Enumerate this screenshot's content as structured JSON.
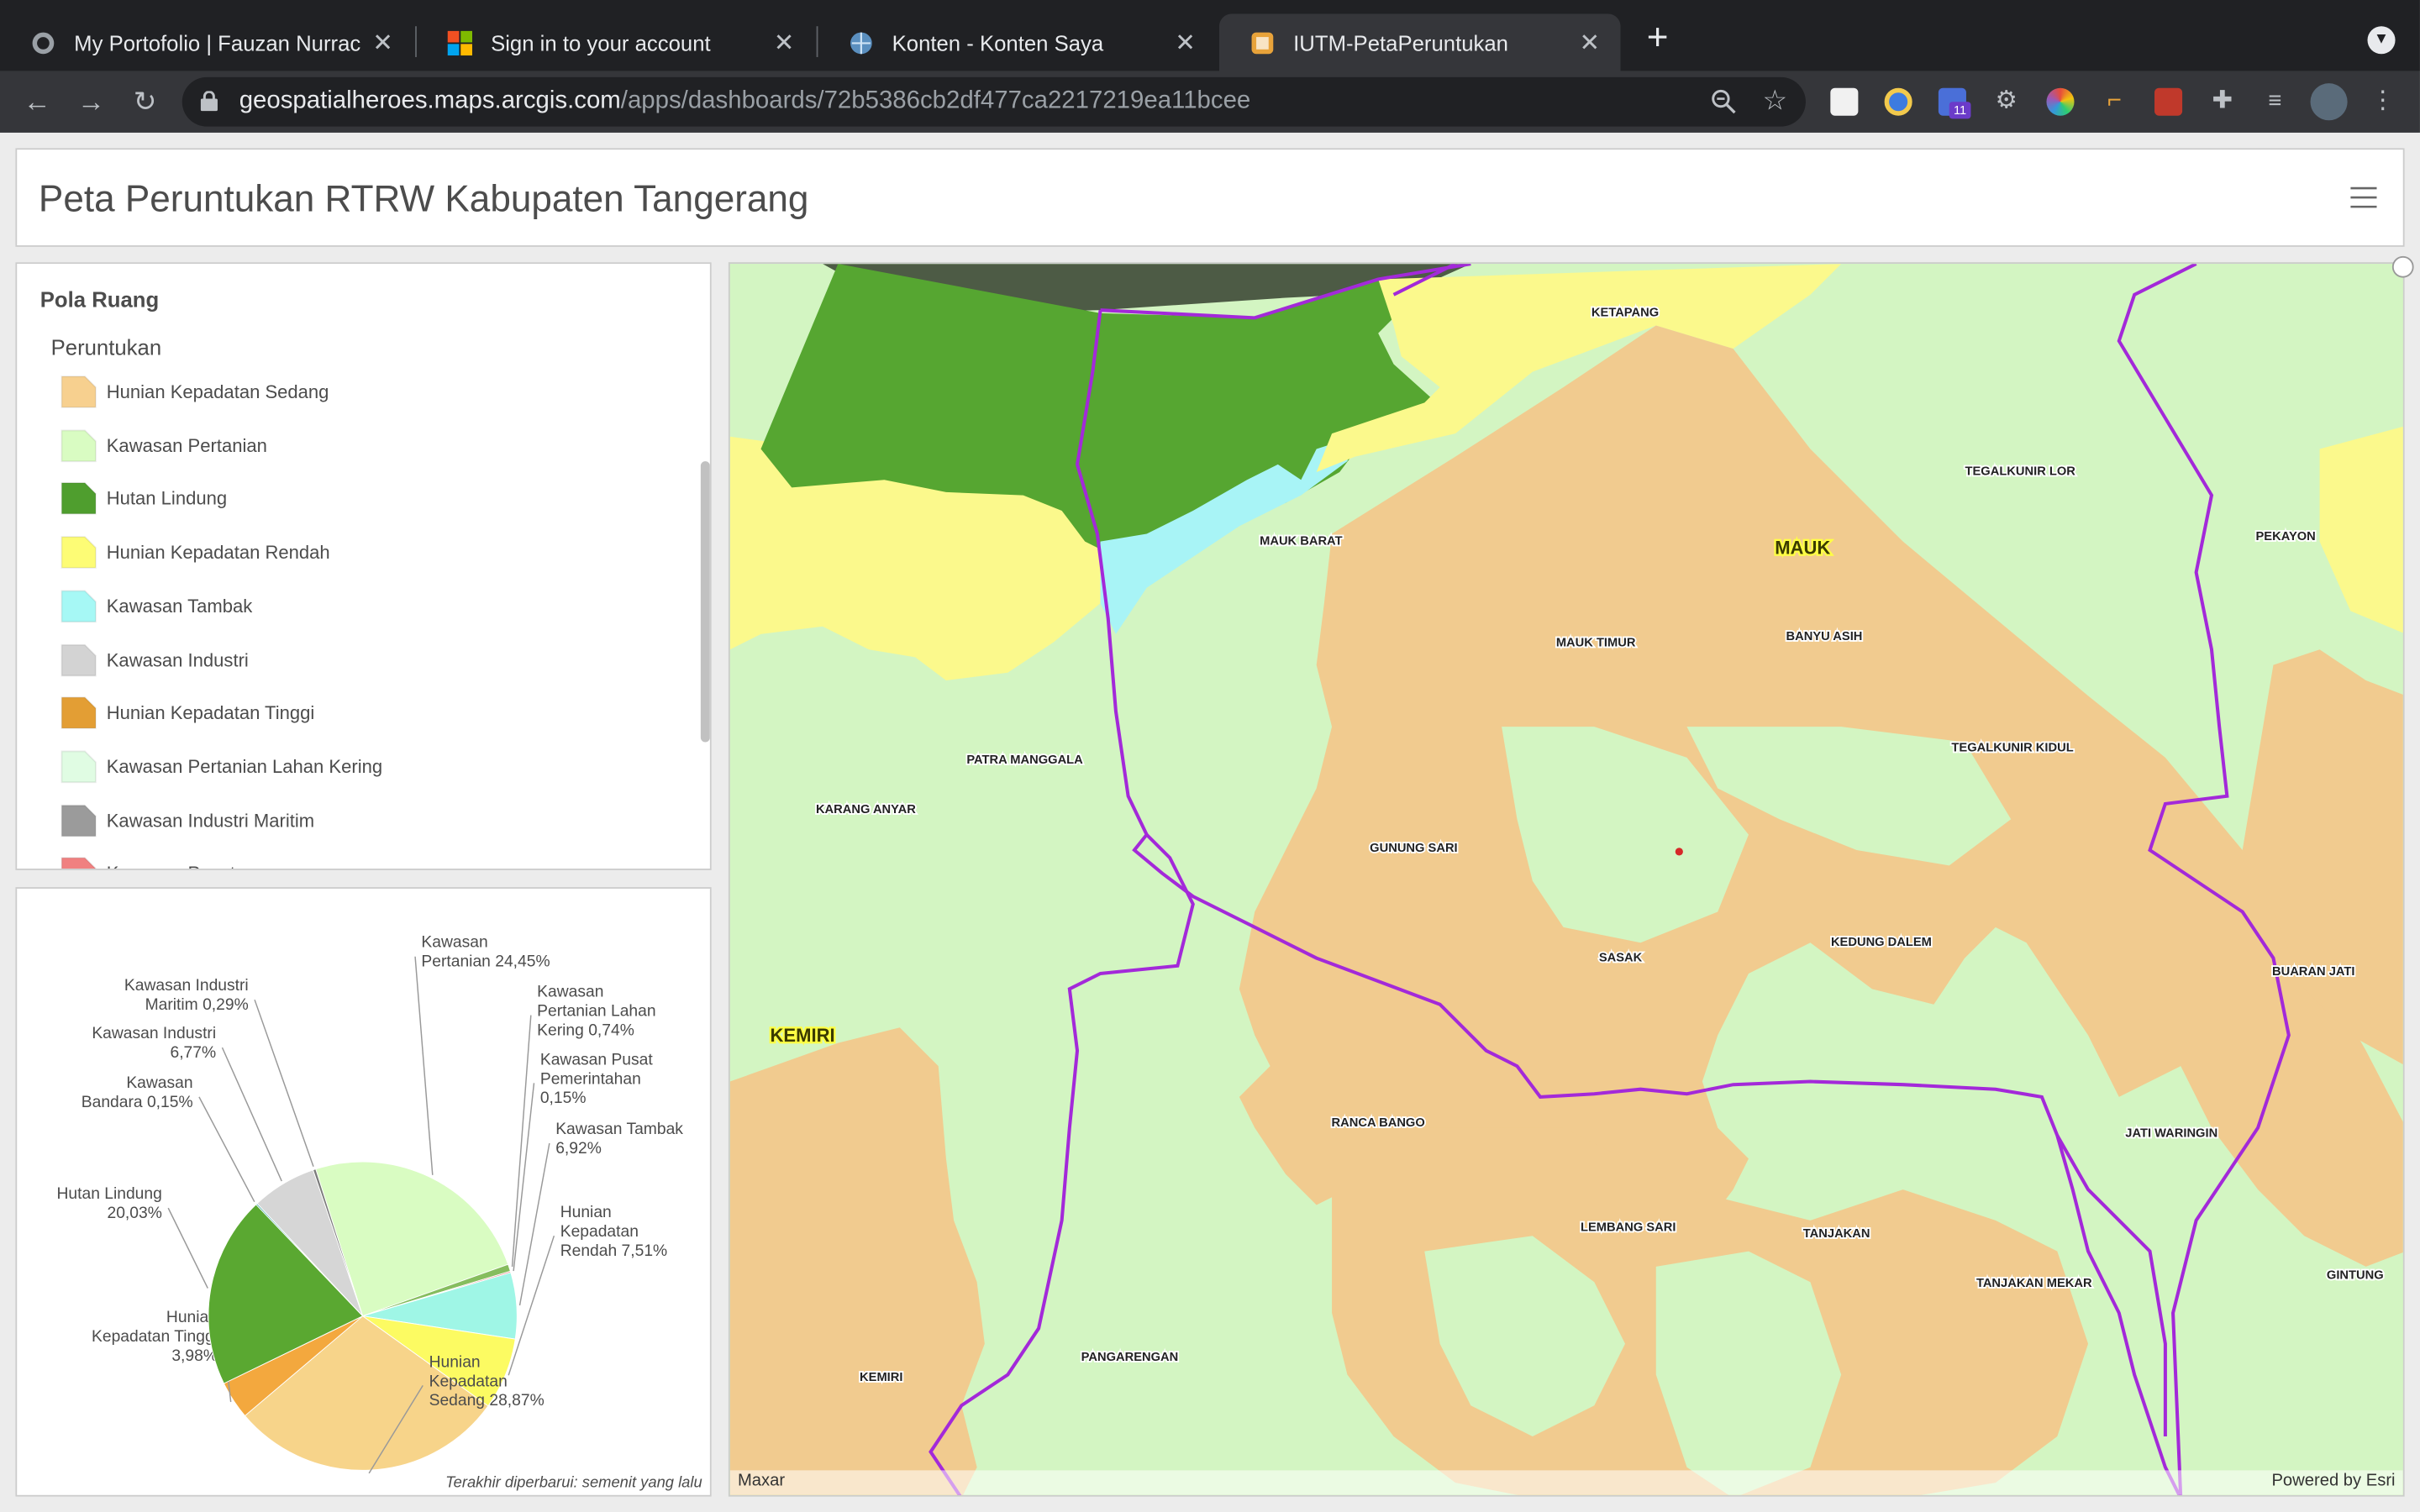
{
  "browser": {
    "tabs": [
      {
        "title": "My Portofolio | Fauzan Nurrach",
        "close": "✕"
      },
      {
        "title": "Sign in to your account",
        "close": "✕"
      },
      {
        "title": "Konten - Konten Saya",
        "close": "✕"
      },
      {
        "title": "IUTM-PetaPeruntukan",
        "close": "✕"
      }
    ],
    "new_tab": "+",
    "url_host": "geospatialheroes.maps.arcgis.com",
    "url_path": "/apps/dashboards/72b5386cb2df477ca2217219ea11bcee",
    "extension_badge": "11"
  },
  "dashboard": {
    "title": "Peta Peruntukan RTRW Kabupaten Tangerang"
  },
  "legend": {
    "title": "Pola Ruang",
    "subtitle": "Peruntukan",
    "items": [
      {
        "label": "Hunian Kepadatan Sedang",
        "color": "#f7d08f"
      },
      {
        "label": "Kawasan Pertanian",
        "color": "#d9fcc2"
      },
      {
        "label": "Hutan Lindung",
        "color": "#4f9e2e"
      },
      {
        "label": "Hunian Kepadatan Rendah",
        "color": "#fdfc75"
      },
      {
        "label": "Kawasan Tambak",
        "color": "#a6f8f5"
      },
      {
        "label": "Kawasan Industri",
        "color": "#d3d3d3"
      },
      {
        "label": "Hunian Kepadatan Tinggi",
        "color": "#e39e34"
      },
      {
        "label": "Kawasan Pertanian Lahan Kering",
        "color": "#e0fce3"
      },
      {
        "label": "Kawasan Industri Maritim",
        "color": "#9b9b9b"
      },
      {
        "label": "Kawasan Pusat",
        "color": "#f08080"
      }
    ]
  },
  "chart_data": {
    "type": "pie",
    "slices": [
      {
        "name": "Kawasan Pertanian",
        "value": 24.45,
        "color": "#d9fcc2",
        "label_lines": [
          "Kawasan",
          "Pertanian 24,45%"
        ]
      },
      {
        "name": "Kawasan Pertanian Lahan Kering",
        "value": 0.74,
        "color": "#86bd5e",
        "label_lines": [
          "Kawasan",
          "Pertanian Lahan",
          "Kering 0,74%"
        ]
      },
      {
        "name": "Kawasan Pusat Pemerintahan",
        "value": 0.15,
        "color": "#ef8a8a",
        "label_lines": [
          "Kawasan Pusat",
          "Pemerintahan",
          "0,15%"
        ]
      },
      {
        "name": "Kawasan Tambak",
        "value": 6.92,
        "color": "#9ff6e6",
        "label_lines": [
          "Kawasan Tambak",
          "6,92%"
        ]
      },
      {
        "name": "Hunian Kepadatan Rendah",
        "value": 7.51,
        "color": "#fcfb62",
        "label_lines": [
          "Hunian",
          "Kepadatan",
          "Rendah 7,51%"
        ]
      },
      {
        "name": "Hunian Kepadatan Sedang",
        "value": 28.87,
        "color": "#f7d48a",
        "label_lines": [
          "Hunian",
          "Kepadatan",
          "Sedang 28,87%"
        ]
      },
      {
        "name": "Hunian Kepadatan Tinggi",
        "value": 3.98,
        "color": "#f3a83e",
        "label_lines": [
          "Hunian",
          "Kepadatan Tinggi",
          "3,98%"
        ]
      },
      {
        "name": "Hutan Lindung",
        "value": 20.03,
        "color": "#5aa831",
        "label_lines": [
          "Hutan Lindung",
          "20,03%"
        ]
      },
      {
        "name": "Kawasan Bandara",
        "value": 0.15,
        "color": "#3aa5a5",
        "label_lines": [
          "Kawasan",
          "Bandara 0,15%"
        ]
      },
      {
        "name": "Kawasan Industri",
        "value": 6.77,
        "color": "#d6d6d6",
        "label_lines": [
          "Kawasan Industri",
          "6,77%"
        ]
      },
      {
        "name": "Kawasan Industri Maritim",
        "value": 0.29,
        "color": "#7a7a7a",
        "label_lines": [
          "Kawasan Industri",
          "Maritim 0,29%"
        ]
      }
    ],
    "updated_note": "Terakhir diperbarui: semenit yang lalu"
  },
  "map": {
    "places": [
      {
        "name": "KETAPANG",
        "big": false
      },
      {
        "name": "TEGALKUNIR LOR",
        "big": false
      },
      {
        "name": "PEKAYON",
        "big": false
      },
      {
        "name": "MAUK BARAT",
        "big": false
      },
      {
        "name": "MAUK",
        "big": true
      },
      {
        "name": "MAUK TIMUR",
        "big": false
      },
      {
        "name": "BANYU ASIH",
        "big": false
      },
      {
        "name": "TEGALKUNIR KIDUL",
        "big": false
      },
      {
        "name": "PATRA MANGGALA",
        "big": false
      },
      {
        "name": "KARANG ANYAR",
        "big": false
      },
      {
        "name": "GUNUNG SARI",
        "big": false
      },
      {
        "name": "SASAK",
        "big": false
      },
      {
        "name": "KEDUNG DALEM",
        "big": false
      },
      {
        "name": "BUARAN JATI",
        "big": false
      },
      {
        "name": "KEMIRI",
        "big": true
      },
      {
        "name": "RANCA BANGO",
        "big": false
      },
      {
        "name": "JATI WARINGIN",
        "big": false
      },
      {
        "name": "LEMBANG SARI",
        "big": false
      },
      {
        "name": "TANJAKAN",
        "big": false
      },
      {
        "name": "TANJAKAN MEKAR",
        "big": false
      },
      {
        "name": "GINTUNG",
        "big": false
      },
      {
        "name": "PANGARENGAN",
        "big": false
      },
      {
        "name": "KEMIRI",
        "big": false
      }
    ],
    "attribution_left": "Maxar",
    "attribution_right": "Powered by Esri"
  }
}
